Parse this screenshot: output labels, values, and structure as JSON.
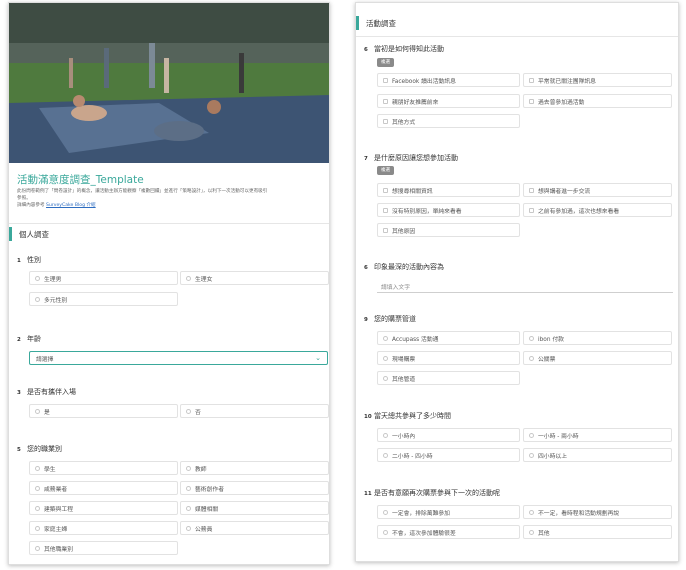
{
  "left": {
    "form_title": "活動滿意度調查_Template",
    "description_line1": "此份問卷範例了「問卷設計」的概念，讓活動主辦方能觀察「複數回饋」並進行「策略設計」，以利下一次活動可以更有吸引",
    "description_line2": "參照。",
    "description_ref_label": "詳細內容參考",
    "description_link": "SurveyCake Blog 介紹",
    "section_title": "個人調查",
    "q1": {
      "num": "1",
      "label": "性別",
      "options": [
        "生理男",
        "生理女",
        "多元性別"
      ]
    },
    "q2": {
      "num": "2",
      "label": "年齡",
      "placeholder": "請選擇",
      "chevron": "⌄"
    },
    "q3": {
      "num": "3",
      "label": "是否有攜伴入場",
      "options": [
        "是",
        "否"
      ]
    },
    "q4": {
      "num": "5",
      "label": "您的職業別",
      "options": [
        "學生",
        "教師",
        "咸務業者",
        "藝術創作者",
        "建築與工程",
        "媒體相關",
        "家庭主婦",
        "公務員",
        "其他職業別"
      ]
    }
  },
  "right": {
    "section_title": "活動調查",
    "q6": {
      "num": "6",
      "label": "當初是如何得知此活動",
      "tag": "複選",
      "options": [
        "Facebook 讀出活動訊息",
        "平常就已關注團隊訊息",
        "親朋好友推薦前來",
        "過去曾參加過活動",
        "其他方式"
      ]
    },
    "q7": {
      "num": "7",
      "label": "是什麼原因讓您想參加活動",
      "tag": "複選",
      "options": [
        "想搜尋相關資訊",
        "想與講者進一步交流",
        "沒有特別原因，單純來看看",
        "之前有參加過，這次也想來看看",
        "其他原因"
      ]
    },
    "q8": {
      "num": "6",
      "label": "印象最深的活動內容為",
      "placeholder": "請填入文字"
    },
    "q9": {
      "num": "9",
      "label": "您的購票管道",
      "options": [
        "Accupass 活動通",
        "ibon 付款",
        "現場購票",
        "公關票",
        "其他管道"
      ]
    },
    "q10": {
      "num": "10",
      "label": "當天總共參與了多少時間",
      "options": [
        "一小時內",
        "一小時 - 兩小時",
        "二小時 - 四小時",
        "四小時以上"
      ]
    },
    "q11": {
      "num": "11",
      "label": "是否有意願再次購票參與下一次的活動呢",
      "options": [
        "一定會，排除萬難參加",
        "不一定，看時程和活動規劃再說",
        "不會，這次參加體驗很差",
        "其他"
      ]
    }
  },
  "colors": {
    "accent": "#3aa89b",
    "tag_bg": "#8a8a8a",
    "border": "#e2e2e2"
  }
}
